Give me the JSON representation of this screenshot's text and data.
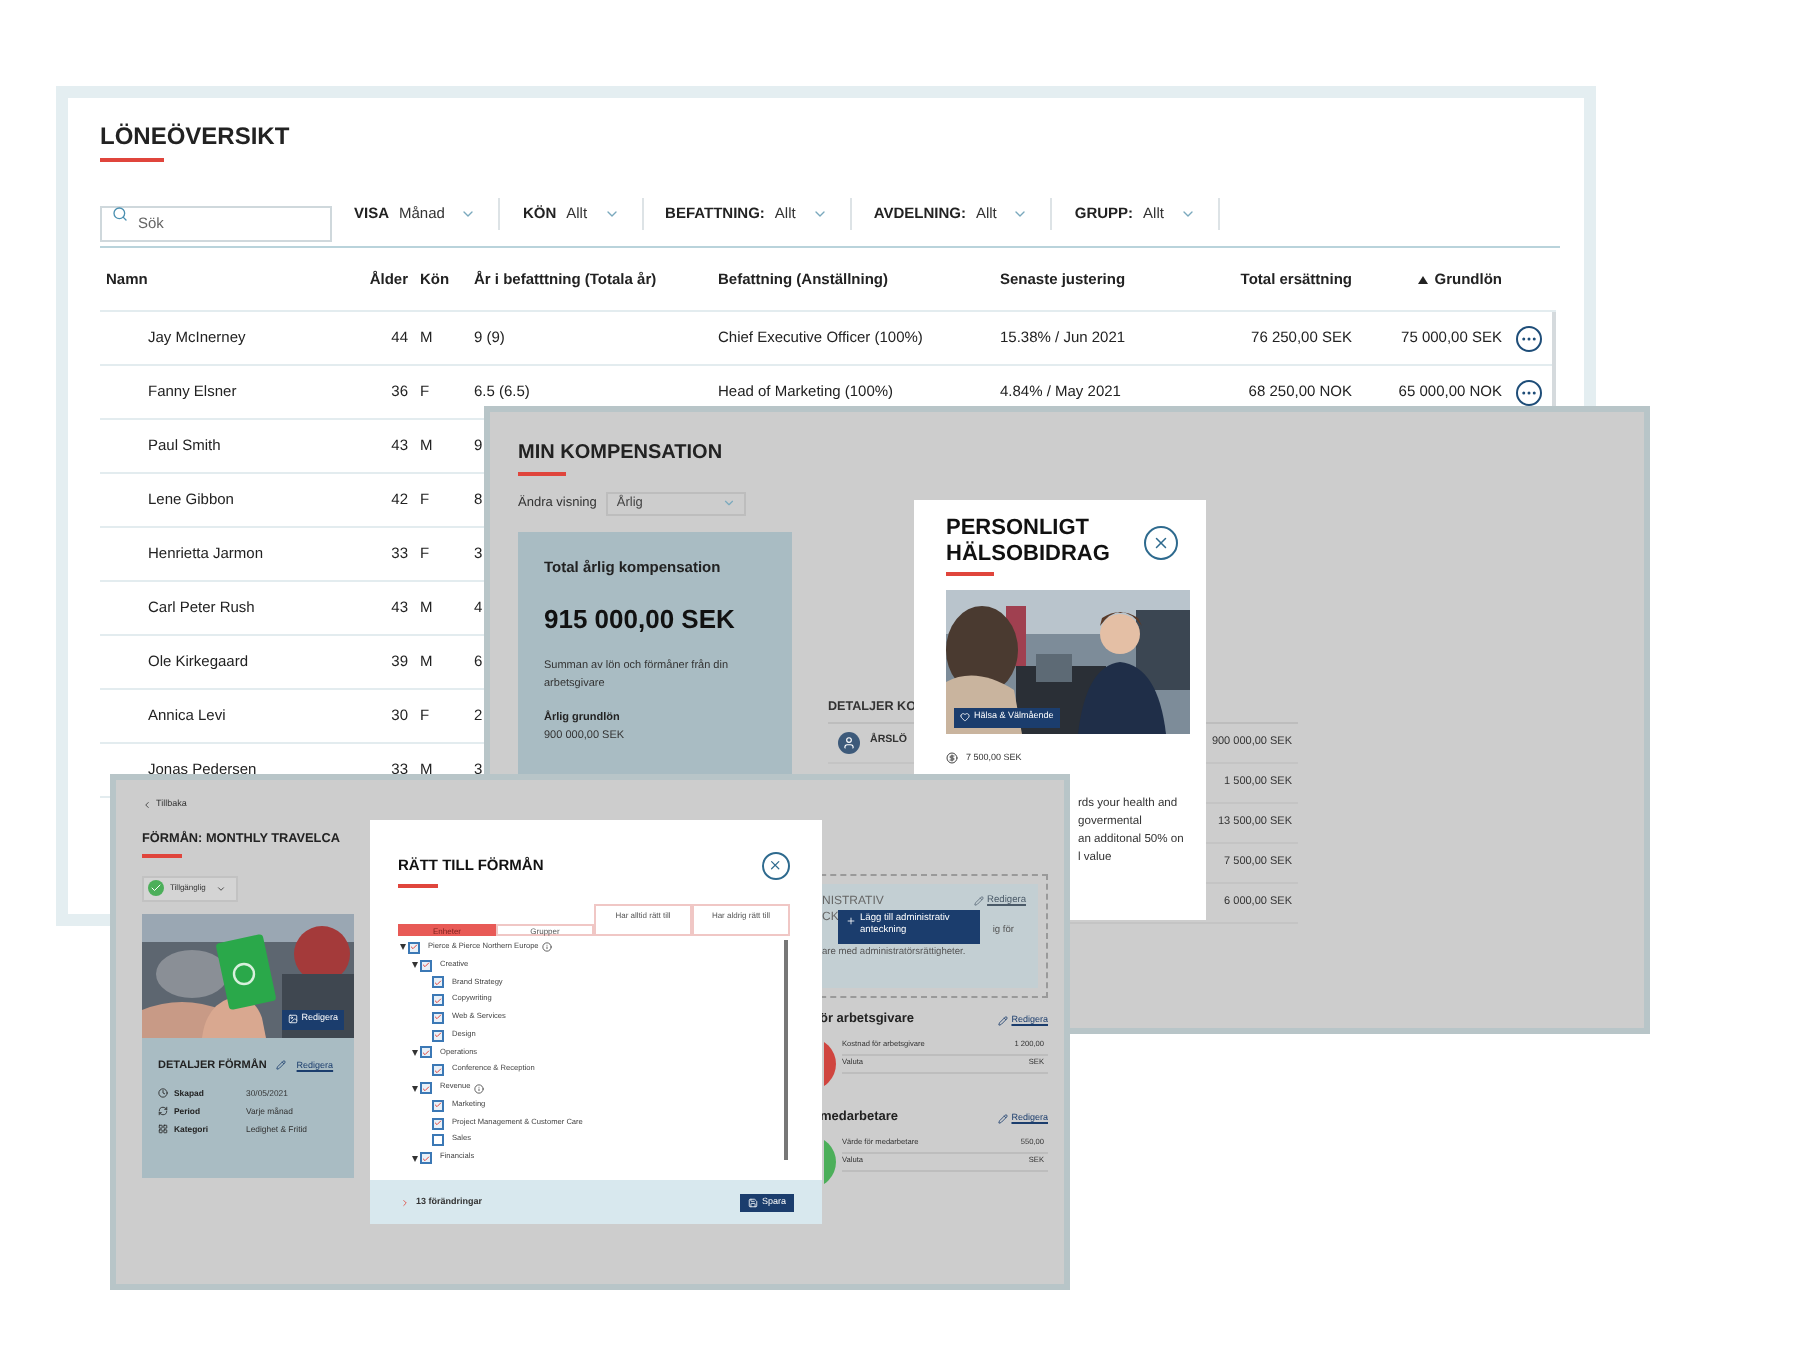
{
  "payroll": {
    "title": "LÖNEÖVERSIKT",
    "search": {
      "placeholder": "Sök"
    },
    "filters": [
      {
        "label": "VISA",
        "value": "Månad"
      },
      {
        "label": "KÖN",
        "value": "Allt"
      },
      {
        "label": "BEFATTNING:",
        "value": "Allt"
      },
      {
        "label": "AVDELNING:",
        "value": "Allt"
      },
      {
        "label": "GRUPP:",
        "value": "Allt"
      }
    ],
    "columns": [
      {
        "label": "Namn",
        "sorted": false
      },
      {
        "label": "Ålder",
        "sorted": false
      },
      {
        "label": "Kön",
        "sorted": false
      },
      {
        "label": "År i befatttning (Totala år)",
        "sorted": false
      },
      {
        "label": "Befattning (Anställning)",
        "sorted": false
      },
      {
        "label": "Senaste justering",
        "sorted": false
      },
      {
        "label": "Total ersättning",
        "sorted": false
      },
      {
        "label": "Grundlön",
        "sorted": true
      }
    ],
    "rows": [
      {
        "cells": [
          "Jay McInerney",
          "44",
          "M",
          "9 (9)",
          "Chief Executive Officer (100%)",
          "15.38% / Jun 2021",
          "76 250,00 SEK",
          "75 000,00 SEK"
        ],
        "menu": true
      },
      {
        "cells": [
          "Fanny Elsner",
          "36",
          "F",
          "6.5 (6.5)",
          "Head of Marketing (100%)",
          "4.84% / May 2021",
          "68 250,00 NOK",
          "65 000,00 NOK"
        ],
        "menu": true
      },
      {
        "cells": [
          "Paul Smith",
          "43",
          "M",
          "9"
        ],
        "menu": false
      },
      {
        "cells": [
          "Lene Gibbon",
          "42",
          "F",
          "8"
        ],
        "menu": false
      },
      {
        "cells": [
          "Henrietta Jarmon",
          "33",
          "F",
          "3"
        ],
        "menu": false
      },
      {
        "cells": [
          "Carl Peter Rush",
          "43",
          "M",
          "4"
        ],
        "menu": false
      },
      {
        "cells": [
          "Ole Kirkegaard",
          "39",
          "M",
          "6"
        ],
        "menu": false
      },
      {
        "cells": [
          "Annica Levi",
          "30",
          "F",
          "2"
        ],
        "menu": false
      },
      {
        "cells": [
          "Jonas Pedersen",
          "33",
          "M",
          "3"
        ],
        "menu": false
      }
    ]
  },
  "compensation": {
    "title": "MIN KOMPENSATION",
    "view_label": "Ändra visning",
    "view_value": "Årlig",
    "summary": {
      "title": "Total årlig kompensation",
      "amount": "915 000,00 SEK",
      "description": "Summan av lön och förmåner från din arbetsgivare",
      "base_label": "Årlig grundlön",
      "base_value": "900 000,00 SEK"
    },
    "details_title": "DETALJER KO",
    "first_row_label": "ÅRSLÖ",
    "values": [
      "900 000,00 SEK",
      "1 500,00 SEK",
      "13 500,00 SEK",
      "7 500,00 SEK",
      "6 000,00 SEK"
    ]
  },
  "health_benefit": {
    "title": "PERSONLIGT HÄLSOBIDRAG",
    "badge": "Hälsa & Välmående",
    "amount": "7 500,00 SEK",
    "description_lines": [
      "rds your health and",
      "govermental",
      "an additonal 50% on",
      "l value"
    ]
  },
  "benefit": {
    "back": "Tillbaka",
    "title": "FÖRMÅN: MONTHLY TRAVELCA",
    "status": "Tillgänglig",
    "photo_edit": "Redigera",
    "details": {
      "title": "DETALJER FÖRMÅN",
      "edit": "Redigera",
      "rows": [
        {
          "kind": "created",
          "label": "Skapad",
          "value": "30/05/2021"
        },
        {
          "kind": "period",
          "label": "Period",
          "value": "Varje månad"
        },
        {
          "kind": "category",
          "label": "Kategori",
          "value": "Ledighet & Fritid"
        }
      ]
    },
    "admin": {
      "title_lines": [
        "NISTRATIV",
        "CK"
      ],
      "edit": "Redigera",
      "tooltip": "Lägg till administrativ anteckning",
      "note_lines": [
        "ig för",
        "are med administratörsrättigheter."
      ]
    },
    "costs": [
      {
        "title": "ör arbetsgivare",
        "edit": "Redigera",
        "color": "#d0453f",
        "rows": [
          {
            "label": "Kostnad för arbetsgivare",
            "value": "1 200,00"
          },
          {
            "label": "Valuta",
            "value": "SEK"
          }
        ]
      },
      {
        "title": "medarbetare",
        "edit": "Redigera",
        "color": "#4caf5a",
        "rows": [
          {
            "label": "Värde för medarbetare",
            "value": "550,00"
          },
          {
            "label": "Valuta",
            "value": "SEK"
          }
        ]
      }
    ]
  },
  "eligibility": {
    "title": "RÄTT TILL FÖRMÅN",
    "tabs": [
      {
        "label": "Enheter",
        "selected": true
      },
      {
        "label": "Grupper",
        "selected": false
      }
    ],
    "column_headers": [
      "Har alltid rätt till",
      "Har aldrig rätt till"
    ],
    "tree": [
      {
        "label": "Pierce & Pierce Northern Europe",
        "checked": true,
        "info": true,
        "expanded": true,
        "children": [
          {
            "label": "Creative",
            "checked": true,
            "info": false,
            "expanded": true,
            "children": [
              {
                "label": "Brand Strategy",
                "checked": true,
                "info": false
              },
              {
                "label": "Copywriting",
                "checked": true,
                "info": false
              },
              {
                "label": "Web & Services",
                "checked": true,
                "info": false
              },
              {
                "label": "Design",
                "checked": true,
                "info": false
              }
            ]
          },
          {
            "label": "Operations",
            "checked": true,
            "info": false,
            "expanded": true,
            "children": [
              {
                "label": "Conference & Reception",
                "checked": true,
                "info": false
              }
            ]
          },
          {
            "label": "Revenue",
            "checked": true,
            "info": true,
            "expanded": true,
            "children": [
              {
                "label": "Marketing",
                "checked": true,
                "info": false
              },
              {
                "label": "Project Management & Customer Care",
                "checked": true,
                "info": false
              },
              {
                "label": "Sales",
                "checked": false,
                "info": false
              }
            ]
          },
          {
            "label": "Financials",
            "checked": true,
            "info": false,
            "expanded": true
          }
        ]
      }
    ],
    "changes": "13 förändringar",
    "save": "Spara"
  }
}
